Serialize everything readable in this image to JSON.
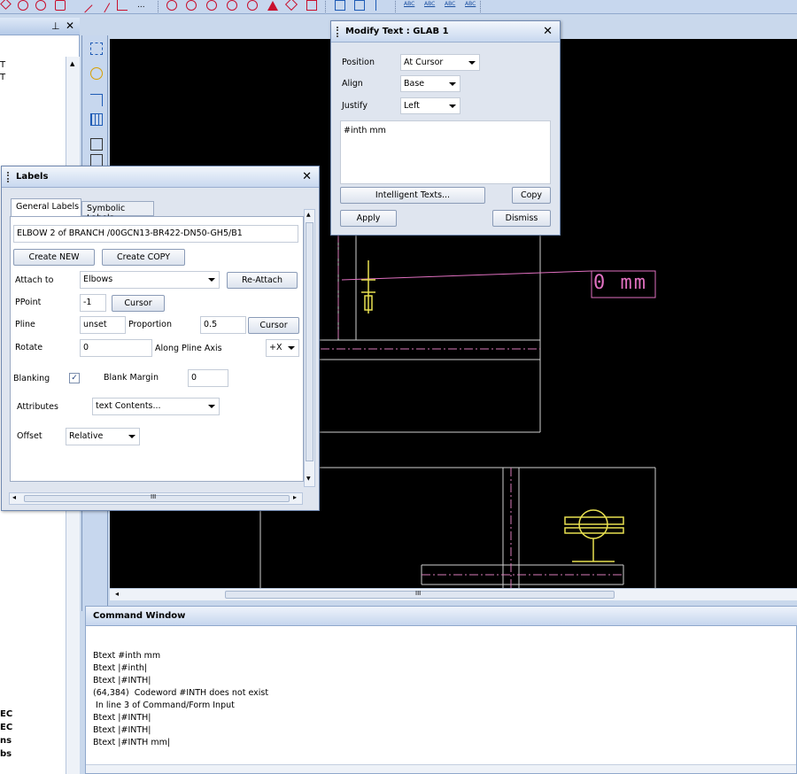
{
  "modify_text": {
    "title": "Modify Text : GLAB 1",
    "position_label": "Position",
    "position_value": "At Cursor",
    "align_label": "Align",
    "align_value": "Base",
    "justify_label": "Justify",
    "justify_value": "Left",
    "text_value": "#inth mm",
    "intelligent_texts_button": "Intelligent Texts...",
    "copy_button": "Copy",
    "apply_button": "Apply",
    "dismiss_button": "Dismiss"
  },
  "labels": {
    "title": "Labels",
    "tab_general": "General Labels",
    "tab_symbolic": "Symbolic Labels",
    "element_name": "ELBOW 2 of BRANCH /00GCN13-BR422-DN50-GH5/B1",
    "create_new_button": "Create NEW",
    "create_copy_button": "Create COPY",
    "attach_to_label": "Attach to",
    "attach_to_value": "Elbows",
    "reattach_button": "Re-Attach",
    "ppoint_label": "PPoint",
    "ppoint_value": "-1",
    "cursor_button": "Cursor",
    "pline_label": "Pline",
    "pline_value": "unset",
    "proportion_label": "Proportion",
    "proportion_value": "0.5",
    "rotate_label": "Rotate",
    "rotate_value": "0",
    "along_label": "Along Pline Axis",
    "along_value": "+X",
    "blanking_label": "Blanking",
    "blanking_checked": "✓",
    "blank_margin_label": "Blank Margin",
    "blank_margin_value": "0",
    "attributes_label": "Attributes",
    "attributes_value": "text Contents...",
    "offset_label": "Offset",
    "offset_value": "Relative",
    "scroll_text": "III"
  },
  "left_panel": {
    "pin": "q",
    "close": "✕",
    "row1": "T",
    "row2": "T",
    "bottom_items": [
      "EC",
      "EC",
      "ns",
      "bs"
    ]
  },
  "canvas": {
    "label_text": "0 mm",
    "scroll_text": "III"
  },
  "command_window": {
    "title": "Command Window",
    "lines": [
      "Btext #inth mm",
      "Btext |#inth|",
      "Btext |#INTH|",
      "(64,384)  Codeword #INTH does not exist",
      " In line 3 of Command/Form Input",
      "Btext |#INTH|",
      "Btext |#INTH|",
      "Btext |#INTH mm|"
    ]
  },
  "toolbar": {
    "abc_labels": [
      "ABC",
      "ABC",
      "ABC",
      "ABC"
    ],
    "ellipsis": "..."
  },
  "colors": {
    "canvas_bg": "#000000",
    "drawing_line": "#ffffff",
    "label_magenta": "#e070c0",
    "support_yellow": "#e8e050"
  }
}
